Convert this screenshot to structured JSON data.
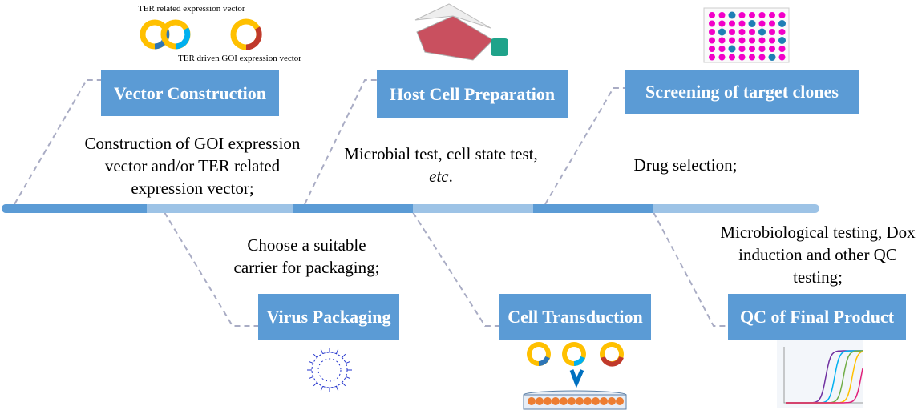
{
  "steps": {
    "vector": {
      "title": "Vector Construction",
      "desc": "Construction of GOI expression vector and/or TER related expression vector;",
      "label_a": "TER related expression vector",
      "label_b": "TER driven GOI expression vector"
    },
    "host": {
      "title": "Host Cell Preparation",
      "desc": "Microbial test, cell state test, ",
      "desc_em": "etc",
      "desc_end": "."
    },
    "screening": {
      "title": "Screening of target clones",
      "desc": "Drug selection;"
    },
    "virus": {
      "title": "Virus Packaging",
      "desc": "Choose a suitable carrier for packaging;"
    },
    "transduction": {
      "title": "Cell Transduction"
    },
    "qc": {
      "title": "QC of Final Product",
      "desc": "Microbiological testing, Dox induction and other QC testing;"
    }
  },
  "colors": {
    "box": "#5b9bd5",
    "timeline_dark": "#5b9bd5",
    "timeline_light": "#9dc3e6",
    "dash": "#a6a6c0"
  }
}
